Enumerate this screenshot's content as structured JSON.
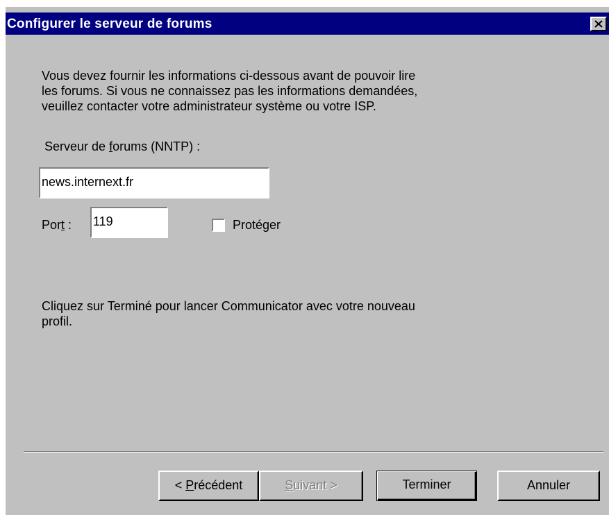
{
  "window": {
    "title": "Configurer le serveur de forums",
    "close_glyph": "×"
  },
  "intro": {
    "line1": "Vous devez fournir les informations ci-dessous avant de pouvoir lire",
    "line2": "les forums. Si vous ne connaissez pas les informations demandées,",
    "line3": "veuillez contacter votre administrateur système ou votre ISP."
  },
  "server": {
    "label_pre": "Serveur de ",
    "label_accel": "f",
    "label_post": "orums (NNTP) :",
    "value": "news.internext.fr"
  },
  "port": {
    "label_pre": "Por",
    "label_accel": "t",
    "label_post": " :",
    "value": "119"
  },
  "secure": {
    "label_pre": "Proté",
    "label_accel": "g",
    "label_post": "er",
    "checked": false
  },
  "finish_text": {
    "line1": "Cliquez sur Terminé pour lancer Communicator avec votre nouveau",
    "line2": "profil."
  },
  "buttons": {
    "previous": {
      "pre": "< ",
      "accel": "P",
      "post": "récédent"
    },
    "next": {
      "pre": "",
      "accel": "S",
      "post": "uivant >"
    },
    "finish": "Terminer",
    "cancel": "Annuler"
  },
  "colors": {
    "titlebar": "#000080",
    "face": "#c0c0c0"
  },
  "icons": {
    "close": "close-icon"
  }
}
